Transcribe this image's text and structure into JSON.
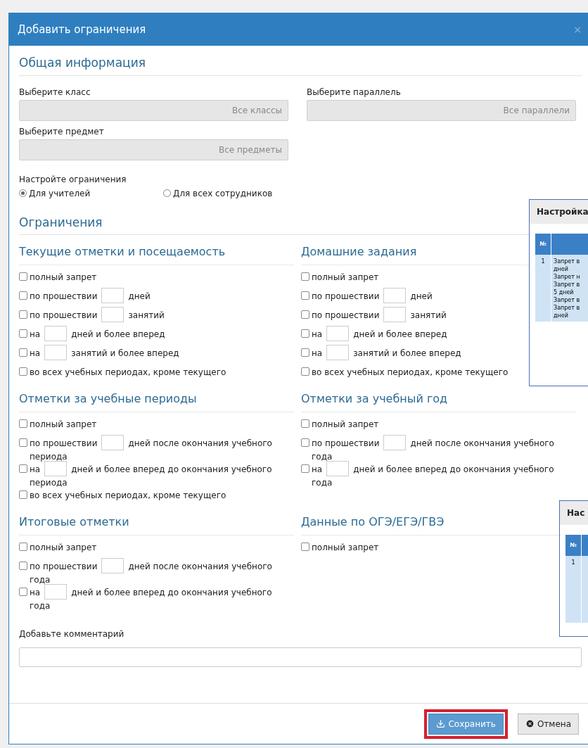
{
  "dialog": {
    "title": "Добавить ограничения",
    "close": "×"
  },
  "general": {
    "heading": "Общая информация",
    "selects": [
      {
        "label": "Выберите класс",
        "value": "Все классы"
      },
      {
        "label": "Выберите параллель",
        "value": "Все параллели"
      },
      {
        "label": "Выберите предмет",
        "value": "Все предметы"
      }
    ],
    "scope": {
      "label": "Настройте ограничения",
      "options": [
        {
          "label": "Для учителей",
          "selected": true
        },
        {
          "label": "Для всех сотрудников",
          "selected": false
        }
      ]
    }
  },
  "restrictions": {
    "heading": "Ограничения",
    "sections": [
      {
        "title": "Текущие отметки и посещаемость",
        "options": [
          {
            "kind": "plain",
            "checked": false,
            "before": "полный запрет"
          },
          {
            "kind": "input",
            "checked": false,
            "before": "по прошествии",
            "after": "дней"
          },
          {
            "kind": "input",
            "checked": false,
            "before": "по прошествии",
            "after": "занятий"
          },
          {
            "kind": "input",
            "checked": false,
            "before": "на",
            "after": "дней и более вперед"
          },
          {
            "kind": "input",
            "checked": false,
            "before": "на",
            "after": "занятий и более вперед"
          },
          {
            "kind": "plain",
            "checked": false,
            "before": "во всех учебных периодах, кроме текущего"
          }
        ]
      },
      {
        "title": "Домашние задания",
        "options": [
          {
            "kind": "plain",
            "checked": false,
            "before": "полный запрет"
          },
          {
            "kind": "input",
            "checked": false,
            "before": "по прошествии",
            "after": "дней"
          },
          {
            "kind": "input",
            "checked": false,
            "before": "по прошествии",
            "after": "занятий"
          },
          {
            "kind": "input",
            "checked": false,
            "before": "на",
            "after": "дней и более вперед"
          },
          {
            "kind": "input",
            "checked": false,
            "before": "на",
            "after": "занятий и более вперед"
          },
          {
            "kind": "plain",
            "checked": false,
            "before": "во всех учебных периодах, кроме текущего"
          }
        ]
      },
      {
        "title": "Отметки за учебные периоды",
        "options": [
          {
            "kind": "plain",
            "checked": false,
            "before": "полный запрет"
          },
          {
            "kind": "input",
            "checked": false,
            "before": "по прошествии",
            "after": "дней после окончания учебного периода"
          },
          {
            "kind": "input",
            "checked": false,
            "before": "на",
            "after": "дней и более вперед до окончания учебного периода"
          },
          {
            "kind": "plain",
            "checked": false,
            "before": "во всех учебных периодах, кроме текущего"
          }
        ]
      },
      {
        "title": "Отметки за учебный год",
        "options": [
          {
            "kind": "plain",
            "checked": false,
            "before": "полный запрет"
          },
          {
            "kind": "input",
            "checked": false,
            "before": "по прошествии",
            "after": "дней после окончания учебного года"
          },
          {
            "kind": "input",
            "checked": false,
            "before": "на",
            "after": "дней и более вперед до окончания учебного года"
          }
        ]
      },
      {
        "title": "Итоговые отметки",
        "options": [
          {
            "kind": "plain",
            "checked": false,
            "before": "полный запрет"
          },
          {
            "kind": "input",
            "checked": false,
            "before": "по прошествии",
            "after": "дней после окончания учебного года"
          },
          {
            "kind": "input",
            "checked": false,
            "before": "на",
            "after": "дней и более вперед до окончания учебного года"
          }
        ]
      },
      {
        "title": "Данные по ОГЭ/ЕГЭ/ГВЭ",
        "options": [
          {
            "kind": "plain",
            "checked": false,
            "before": "полный запрет"
          }
        ]
      }
    ]
  },
  "comment": {
    "label": "Добавьте комментарий"
  },
  "buttons": [
    {
      "label": "Сохранить",
      "kind": "primary",
      "highlighted": true
    },
    {
      "label": "Отмена",
      "kind": "secondary",
      "highlighted": false
    }
  ],
  "background_panels": [
    {
      "title": "Настройка",
      "header": "№",
      "number": "1",
      "lines": [
        "Запрет в",
        "дней",
        "Запрет н",
        "Запрет в",
        "5 дней",
        "Запрет в",
        "Запрет в",
        "дней"
      ]
    },
    {
      "title": "Нас",
      "header": "№",
      "number": "1"
    }
  ]
}
